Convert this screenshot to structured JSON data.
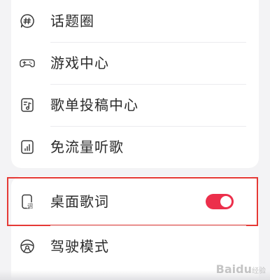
{
  "menu": {
    "items": [
      {
        "label": "话题圈",
        "icon": "hashtag-bubble-icon"
      },
      {
        "label": "游戏中心",
        "icon": "gamepad-icon"
      },
      {
        "label": "歌单投稿中心",
        "icon": "music-note-icon"
      },
      {
        "label": "免流量听歌",
        "icon": "signal-bars-icon"
      }
    ]
  },
  "settings": {
    "desktop_lyrics": {
      "label": "桌面歌词",
      "icon": "phone-lyrics-icon",
      "enabled": true
    },
    "driving_mode": {
      "label": "驾驶模式",
      "icon": "steering-wheel-icon"
    }
  },
  "watermark": {
    "text": "Baidu",
    "sub": "经验"
  },
  "colors": {
    "toggle_on": "#ec2f4b",
    "highlight_border": "#e53935",
    "background": "#f3f3f5"
  }
}
